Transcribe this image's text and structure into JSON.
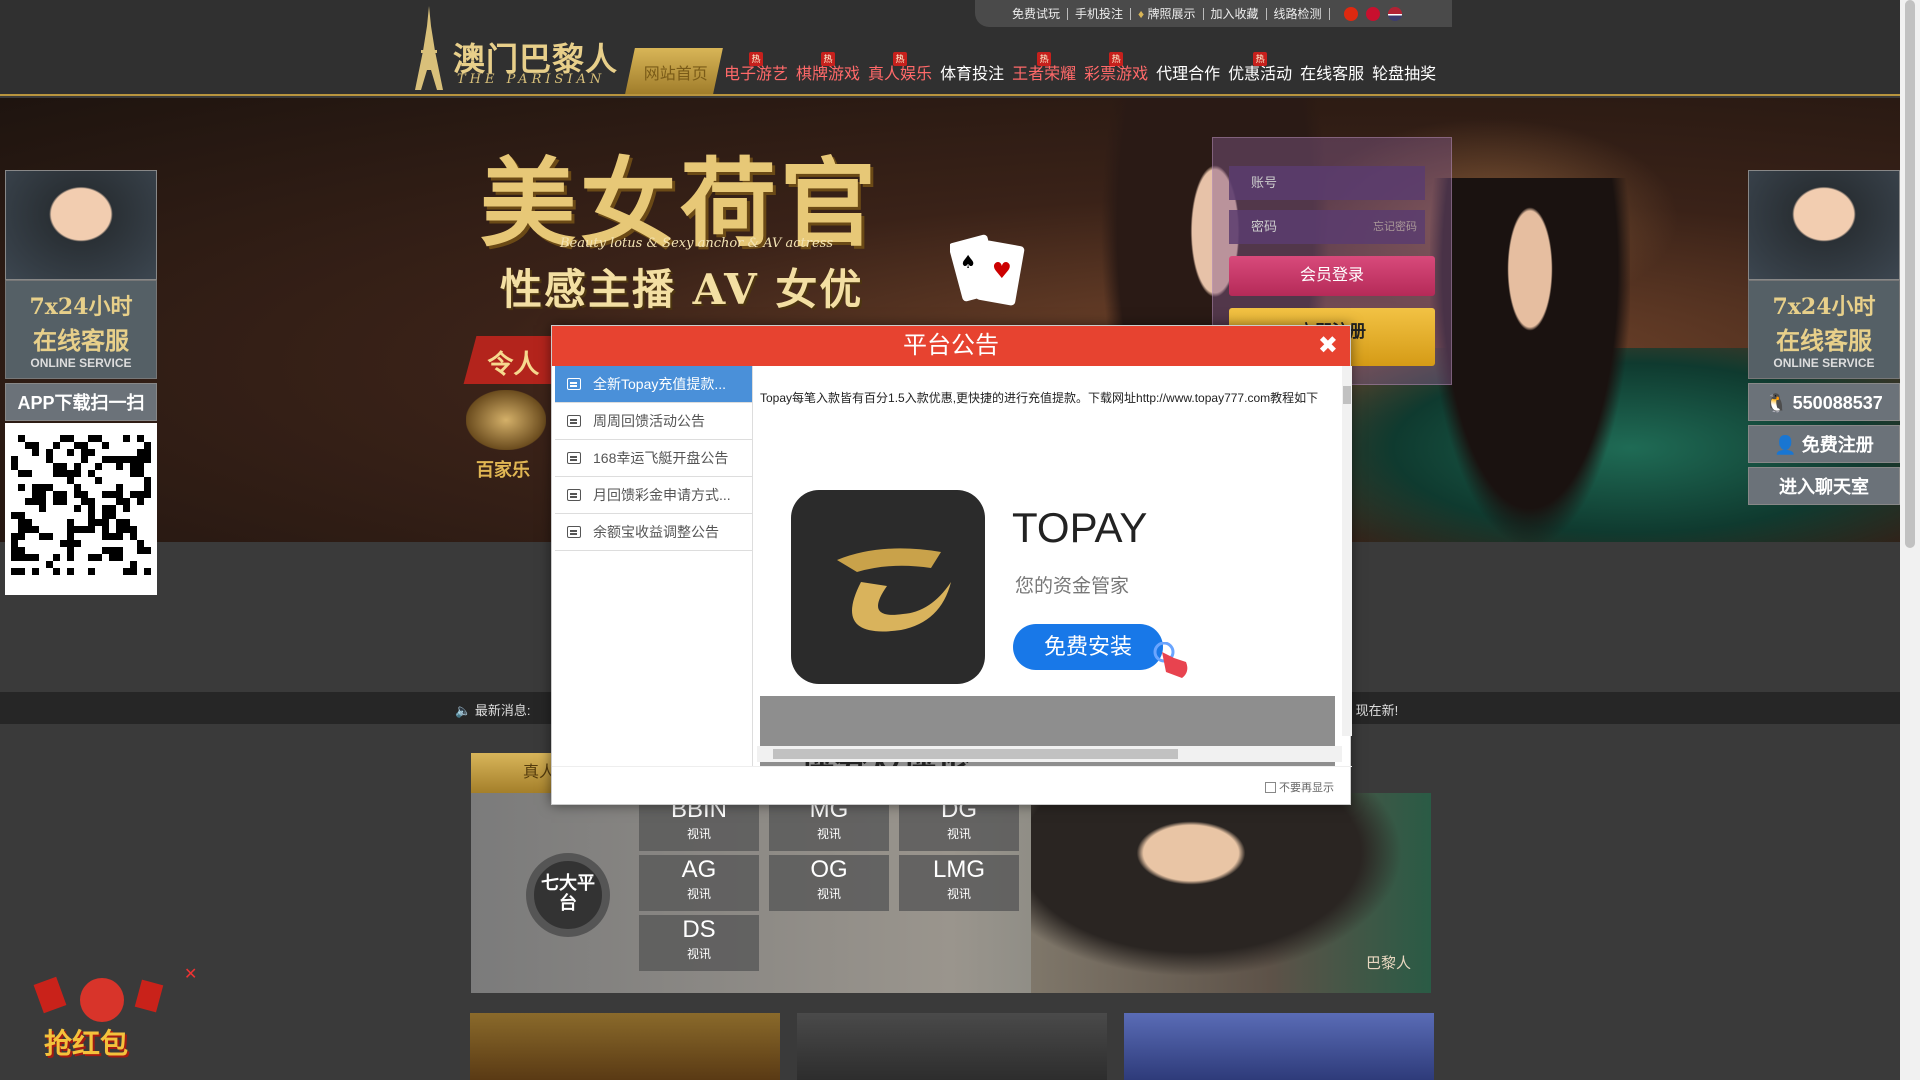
{
  "topbar": {
    "links": [
      "免费试玩",
      "手机投注",
      "牌照展示",
      "加入收藏",
      "线路检测"
    ],
    "flags": [
      "hk-flag-icon",
      "cn-flag-icon",
      "us-flag-icon"
    ]
  },
  "logo": {
    "cn": "澳门巴黎人",
    "en": "THE PARISIAN"
  },
  "nav": {
    "items": [
      "网站首页",
      "电子游艺",
      "棋牌游戏",
      "真人娱乐",
      "体育投注",
      "王者荣耀",
      "彩票游戏",
      "代理合作",
      "优惠活动",
      "在线客服",
      "轮盘抽奖"
    ],
    "hot_badge": "热"
  },
  "banner": {
    "title": "美女荷官",
    "subtitle_en": "Beauty lotus & Sexy anchor & AV actress",
    "subtitle": "性感主播 AV 女优",
    "ribbon": "令人",
    "baccarat": "百家乐"
  },
  "login": {
    "account_placeholder": "账号",
    "password_placeholder": "密码",
    "forgot": "忘记密码",
    "login_button": "会员登录",
    "register_button": "立即注册"
  },
  "side_left": {
    "line1": "7x24小时",
    "line2": "在线客服",
    "line3": "ONLINE SERVICE",
    "app_download": "APP下载扫一扫"
  },
  "side_right": {
    "line1": "7x24小时",
    "line2": "在线客服",
    "line3": "ONLINE SERVICE",
    "qq": "550088537",
    "register": "免费注册",
    "chat": "进入聊天室"
  },
  "news": {
    "label": "最新消息:",
    "text": "式上线。 现在新!"
  },
  "live": {
    "tab": "真人",
    "badge": "七大平台",
    "platforms": [
      {
        "name": "BBIN",
        "sub": "视讯"
      },
      {
        "name": "MG",
        "sub": "视讯"
      },
      {
        "name": "DG",
        "sub": "视讯"
      },
      {
        "name": "AG",
        "sub": "视讯"
      },
      {
        "name": "OG",
        "sub": "视讯"
      },
      {
        "name": "LMG",
        "sub": "视讯"
      },
      {
        "name": "DS",
        "sub": "视讯"
      }
    ],
    "brand": "巴黎人"
  },
  "hongbao": {
    "label": "抢红包"
  },
  "modal": {
    "title": "平台公告",
    "close": "✖",
    "items": [
      "全新Topay充值提款...",
      "周周回馈活动公告",
      "168幸运飞艇开盘公告",
      "月回馈彩金申请方式...",
      "余额宝收益调整公告"
    ],
    "body_text": "Topay每笔入款皆有百分1.5入款优惠,更快捷的进行充值提款。下载网址http://www.topay777.com教程如下",
    "app_name": "TOPAY",
    "app_slogan": "您的资金管家",
    "install_button": "免费安装",
    "review_title": "评分及评论",
    "dont_show": "不要再显示"
  },
  "colors": {
    "header_bg": "#303030",
    "gold": "#d8b557",
    "modal_header": "#e74330",
    "active_item": "#4a90d9",
    "install_blue": "#1878e8"
  }
}
